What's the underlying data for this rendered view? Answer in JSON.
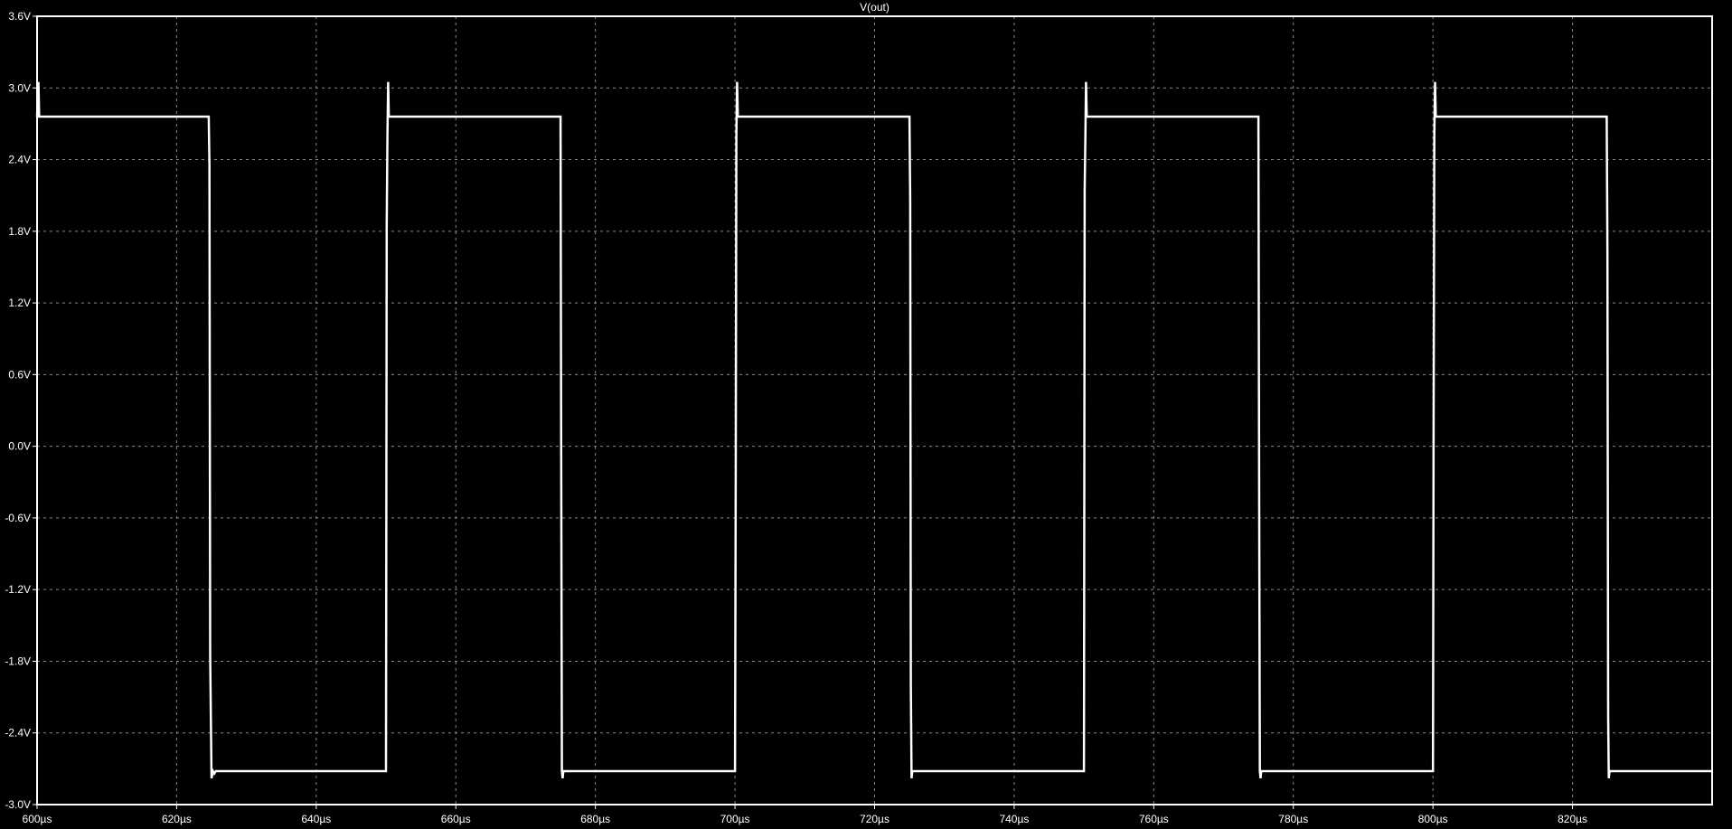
{
  "chart_data": {
    "type": "line",
    "title": "V(out)",
    "xlabel": "",
    "ylabel": "",
    "xlim": [
      600,
      840
    ],
    "ylim": [
      -3.0,
      3.6
    ],
    "grid": true,
    "x_ticks": [
      600,
      620,
      640,
      660,
      680,
      700,
      720,
      740,
      760,
      780,
      800,
      820
    ],
    "x_tick_labels": [
      "600µs",
      "620µs",
      "640µs",
      "660µs",
      "680µs",
      "700µs",
      "720µs",
      "740µs",
      "760µs",
      "780µs",
      "800µs",
      "820µs"
    ],
    "y_ticks": [
      3.6,
      3.0,
      2.4,
      1.8,
      1.2,
      0.6,
      0.0,
      -0.6,
      -1.2,
      -1.8,
      -2.4,
      -3.0
    ],
    "y_tick_labels": [
      "3.6V",
      "3.0V",
      "2.4V",
      "1.8V",
      "1.2V",
      "0.6V",
      "0.0V",
      "-0.6V",
      "-1.2V",
      "-1.8V",
      "-2.4V",
      "-3.0V"
    ],
    "series": [
      {
        "color": "#ffffff",
        "x": [
          600,
          600.2,
          600.3,
          600.4,
          624.6,
          624.7,
          624.8,
          625.0,
          625.2,
          625.4,
          625.6,
          650.0,
          650.1,
          650.2,
          650.3,
          650.4,
          650.6,
          675.0,
          675.1,
          675.2,
          675.3,
          675.4,
          675.6,
          700.0,
          700.1,
          700.2,
          700.3,
          700.4,
          700.6,
          725.0,
          725.1,
          725.2,
          725.3,
          725.4,
          725.6,
          750.0,
          750.1,
          750.2,
          750.3,
          750.4,
          750.6,
          775.0,
          775.1,
          775.2,
          775.3,
          775.4,
          775.6,
          800.0,
          800.1,
          800.2,
          800.3,
          800.4,
          800.6,
          824.9,
          825.0,
          825.1,
          825.2,
          825.3,
          825.5,
          839.9
        ],
        "y": [
          2.76,
          3.05,
          2.76,
          2.76,
          2.76,
          2.35,
          -1.75,
          -2.78,
          -2.72,
          -2.74,
          -2.72,
          -2.72,
          1.85,
          2.6,
          3.05,
          2.76,
          2.76,
          2.76,
          -0.05,
          -2.72,
          -2.78,
          -2.72,
          -2.72,
          -2.72,
          -0.25,
          2.6,
          3.05,
          2.76,
          2.76,
          2.76,
          2.05,
          -2.0,
          -2.78,
          -2.72,
          -2.72,
          -2.72,
          2.15,
          2.6,
          3.05,
          2.76,
          2.76,
          2.76,
          -0.3,
          -2.72,
          -2.78,
          -2.72,
          -2.72,
          -2.72,
          0.15,
          2.6,
          3.05,
          2.76,
          2.76,
          2.76,
          1.6,
          -2.25,
          -2.78,
          -2.72,
          -2.72,
          -2.72
        ]
      }
    ]
  }
}
